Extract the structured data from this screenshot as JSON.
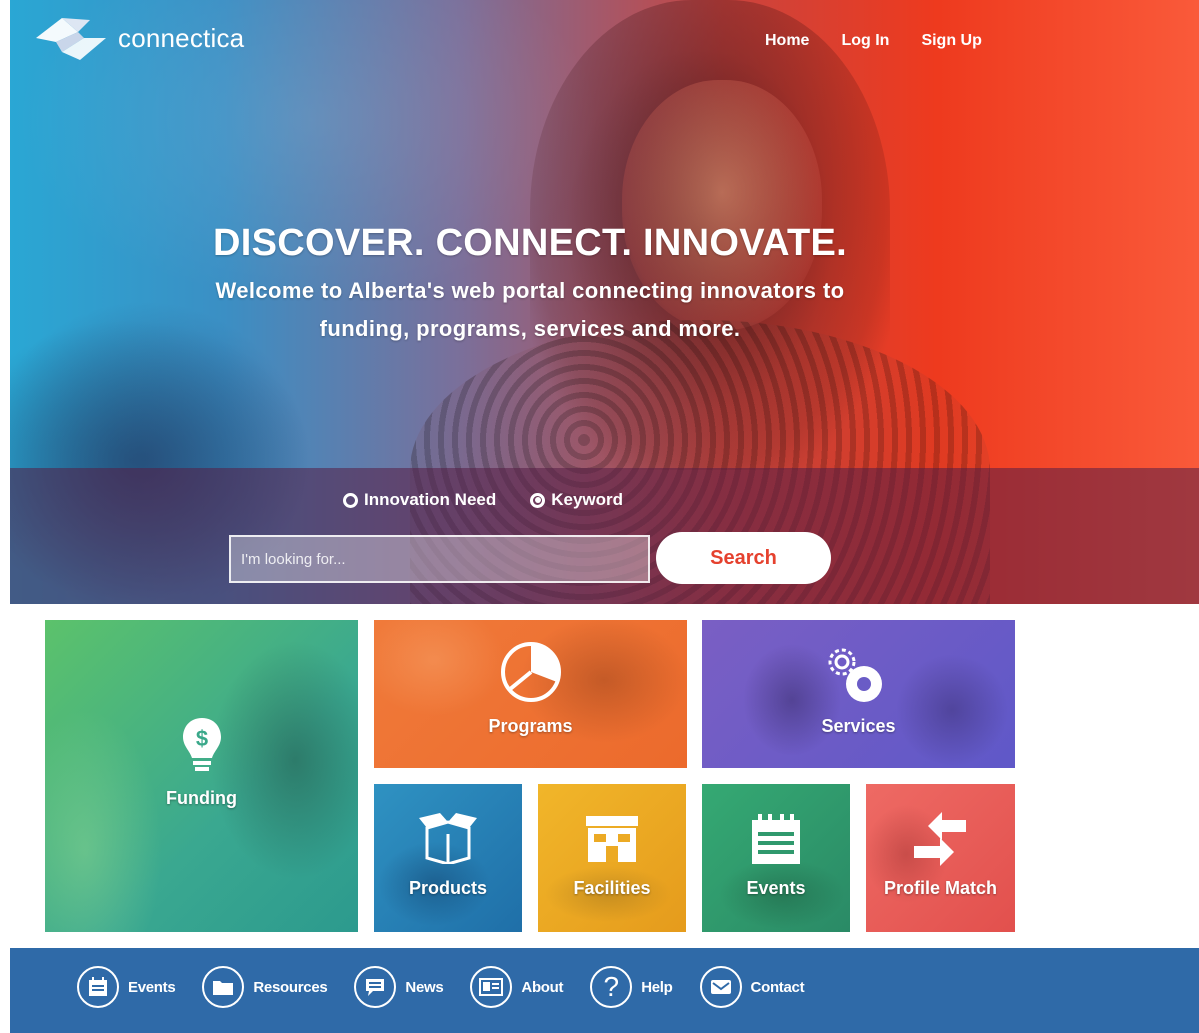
{
  "brand": {
    "name": "connectica"
  },
  "nav": {
    "home": "Home",
    "login": "Log In",
    "signup": "Sign Up"
  },
  "hero": {
    "headline": "DISCOVER. CONNECT. INNOVATE.",
    "subline_1": "Welcome to Alberta's web portal connecting innovators to",
    "subline_2": "funding, programs, services and more."
  },
  "search": {
    "options": [
      {
        "label": "Innovation Need",
        "selected": false
      },
      {
        "label": "Keyword",
        "selected": true
      }
    ],
    "placeholder": "I'm looking for...",
    "button": "Search"
  },
  "tiles": {
    "funding": {
      "label": "Funding",
      "icon": "lightbulb-dollar-icon",
      "color": "#4fb87a"
    },
    "programs": {
      "label": "Programs",
      "icon": "pie-chart-icon",
      "color": "#ef7436"
    },
    "services": {
      "label": "Services",
      "icon": "gears-icon",
      "color": "#6a5cc6"
    },
    "products": {
      "label": "Products",
      "icon": "open-box-icon",
      "color": "#2883b8"
    },
    "facilities": {
      "label": "Facilities",
      "icon": "building-icon",
      "color": "#ecaa24"
    },
    "events": {
      "label": "Events",
      "icon": "calendar-icon",
      "color": "#30996d"
    },
    "profile_match": {
      "label": "Profile Match",
      "icon": "arrows-match-icon",
      "color": "#e95d59"
    }
  },
  "footer": {
    "items": [
      {
        "label": "Events",
        "icon": "calendar-icon"
      },
      {
        "label": "Resources",
        "icon": "folder-icon"
      },
      {
        "label": "News",
        "icon": "speech-bubble-icon"
      },
      {
        "label": "About",
        "icon": "id-card-icon"
      },
      {
        "label": "Help",
        "icon": "question-icon"
      },
      {
        "label": "Contact",
        "icon": "envelope-icon"
      }
    ],
    "color": "#2f6aa8"
  }
}
